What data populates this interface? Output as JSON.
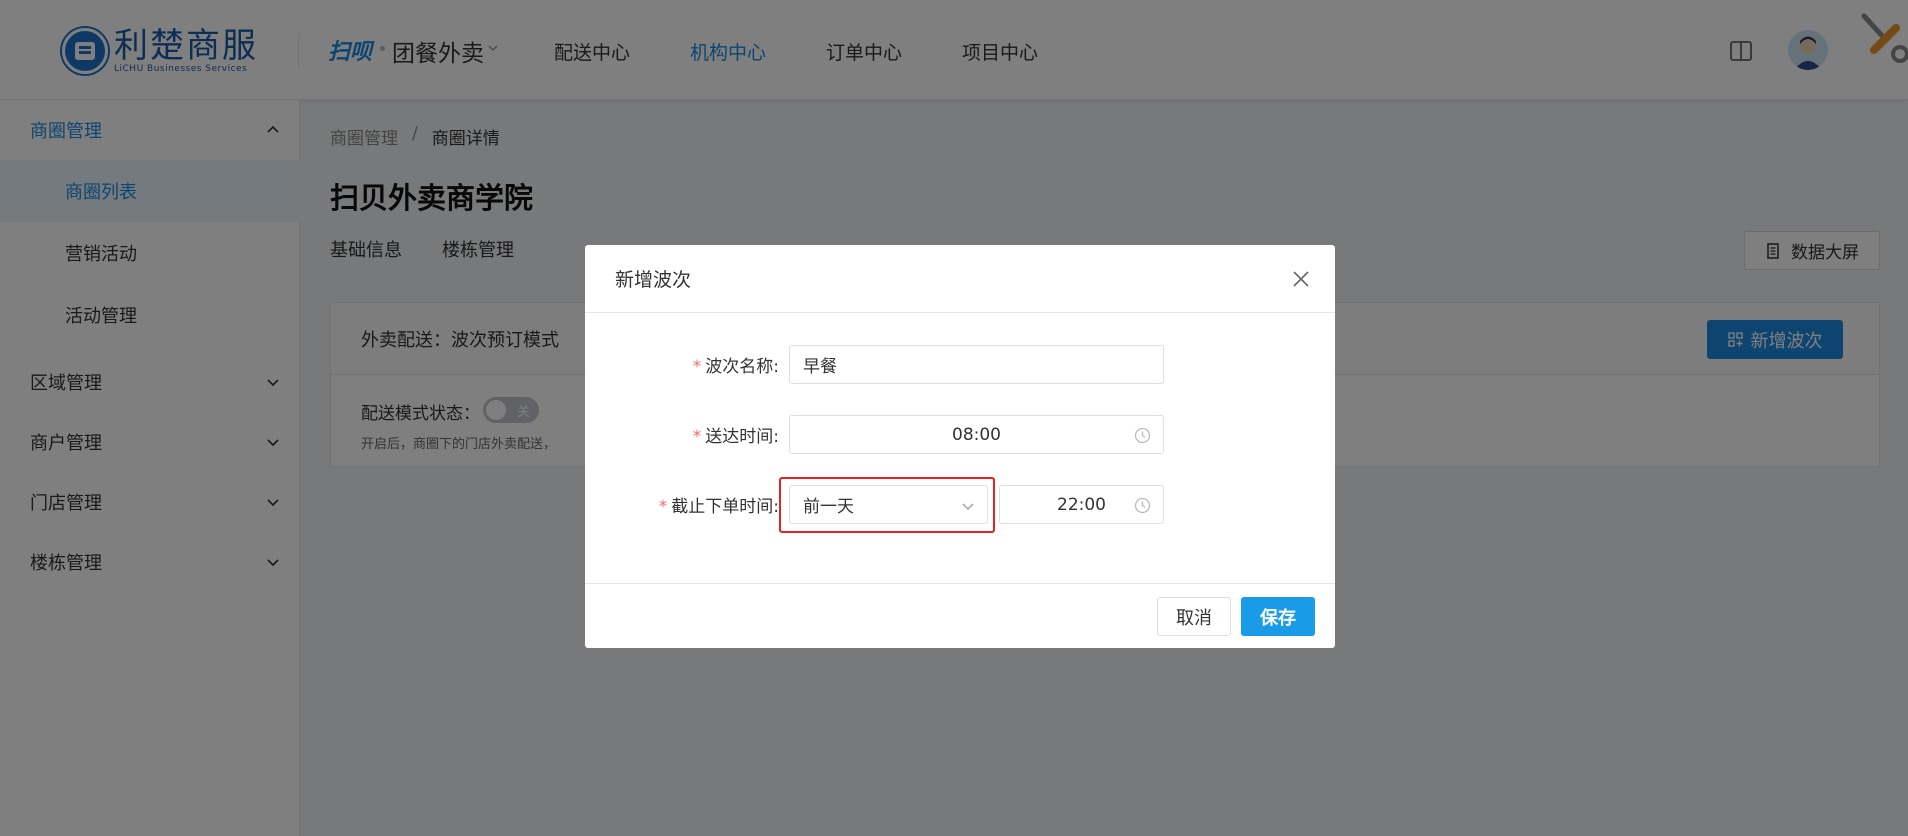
{
  "header": {
    "logo_cn": "利楚商服",
    "logo_en": "LiCHU Businesses Services",
    "brand_mark": "扫呗",
    "brand_name": "团餐外卖",
    "nav": [
      "配送中心",
      "机构中心",
      "订单中心",
      "项目中心"
    ],
    "active_nav_index": 1
  },
  "sidebar": {
    "group_open": "商圈管理",
    "items": [
      "商圈列表",
      "营销活动",
      "活动管理"
    ],
    "active_item_index": 0,
    "groups": [
      "区域管理",
      "商户管理",
      "门店管理",
      "楼栋管理"
    ]
  },
  "main": {
    "breadcrumb": [
      "商圈管理",
      "/",
      "商圈详情"
    ],
    "title": "扫贝外卖商学院",
    "tabs": [
      "基础信息",
      "楼栋管理"
    ],
    "bigscreen_label": "数据大屏",
    "panel_title": "外卖配送：波次预订模式",
    "add_wave_label": "新增波次",
    "mode_label": "配送模式状态：",
    "toggle_text": "关",
    "mode_hint": "开启后，商圈下的门店外卖配送，"
  },
  "modal": {
    "title": "新增波次",
    "name_label": "波次名称:",
    "name_value": "早餐",
    "delivery_label": "送达时间:",
    "delivery_value": "08:00",
    "cutoff_label": "截止下单时间:",
    "cutoff_day": "前一天",
    "cutoff_time": "22:00",
    "cancel_label": "取消",
    "save_label": "保存"
  },
  "colors": {
    "accent": "#1a8ae0",
    "highlight": "#e62222",
    "required": "#f56c6c"
  }
}
